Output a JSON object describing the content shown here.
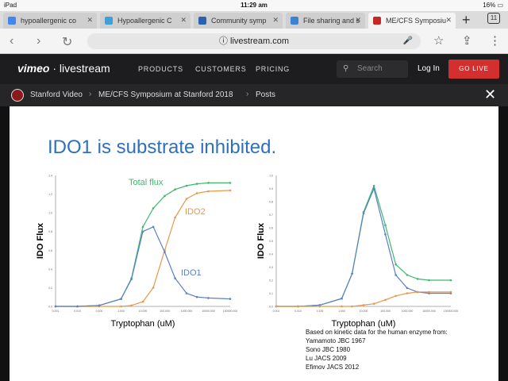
{
  "status": {
    "device": "iPad",
    "time": "11:29 am",
    "battery": "16%"
  },
  "tabs": [
    {
      "label": "hypoallergenic co",
      "icon_color": "#4285f4",
      "icon": "google-icon"
    },
    {
      "label": "Hypoallergenic C",
      "icon_color": "#3ea0d8",
      "icon": "site-icon"
    },
    {
      "label": "Community symp",
      "icon_color": "#2a62b0",
      "icon": "checkmark-icon"
    },
    {
      "label": "File sharing and s",
      "icon_color": "#3b82d6",
      "icon": "file-icon"
    },
    {
      "label": "ME/CFS Symposiu",
      "icon_color": "#c62828",
      "icon": "site-icon"
    }
  ],
  "tab_count": "11",
  "url": "livestream.com",
  "site": {
    "logo_vimeo": "vimeo",
    "logo_livestream": "· livestream",
    "nav": [
      "PRODUCTS",
      "CUSTOMERS",
      "PRICING"
    ],
    "search_placeholder": "Search",
    "login": "Log In",
    "golive": "GO LIVE"
  },
  "breadcrumb": [
    "Stanford Video",
    "ME/CFS Symposium at Stanford 2018",
    "Posts"
  ],
  "slide": {
    "title": "IDO1 is substrate inhibited.",
    "notes": [
      "Based on kinetic data for the human enzyme from:",
      "Yamamoto JBC 1967",
      "Sono JBC 1980",
      "Lu JACS 2009",
      "Efimov JACS 2012"
    ]
  },
  "colors": {
    "total": "#3fb86f",
    "ido1": "#5b7fc8",
    "ido2": "#e8974a"
  },
  "chart_data": [
    {
      "type": "line",
      "xlabel": "Tryptophan (uM)",
      "ylabel": "IDO Flux",
      "x_scale": "log",
      "x_ticks": [
        "0.001",
        "0.010",
        "0.100",
        "1.000",
        "10.000",
        "100.000",
        "1000.000",
        "10000.000",
        "100000.000"
      ],
      "y_ticks": [
        "0.0",
        "0.2",
        "0.4",
        "0.6",
        "0.8",
        "1.0",
        "1.2",
        "1.4"
      ],
      "ylim": [
        0,
        1.4
      ],
      "x": [
        0.001,
        0.01,
        0.1,
        1,
        3,
        10,
        30,
        100,
        300,
        1000,
        3000,
        10000,
        100000
      ],
      "series": [
        {
          "name": "Total flux",
          "color_key": "total",
          "values": [
            0.0,
            0.0,
            0.01,
            0.08,
            0.3,
            0.85,
            1.05,
            1.18,
            1.25,
            1.29,
            1.31,
            1.32,
            1.32
          ]
        },
        {
          "name": "IDO2",
          "color_key": "ido2",
          "values": [
            0.0,
            0.0,
            0.0,
            0.0,
            0.01,
            0.05,
            0.2,
            0.6,
            0.95,
            1.15,
            1.21,
            1.23,
            1.24
          ]
        },
        {
          "name": "IDO1",
          "color_key": "ido1",
          "values": [
            0.0,
            0.0,
            0.01,
            0.08,
            0.29,
            0.8,
            0.85,
            0.58,
            0.3,
            0.14,
            0.1,
            0.09,
            0.08
          ]
        }
      ]
    },
    {
      "type": "line",
      "xlabel": "Tryptophan (uM)",
      "ylabel": "IDO Flux",
      "x_scale": "log",
      "x_ticks": [
        "0.001",
        "0.010",
        "0.100",
        "1.000",
        "10.000",
        "100.000",
        "1000.000",
        "10000.000",
        "100000.000"
      ],
      "y_ticks": [
        "0.0",
        "0.1",
        "0.2",
        "0.3",
        "0.4",
        "0.5",
        "0.6",
        "0.7",
        "0.8",
        "0.9",
        "1.0"
      ],
      "ylim": [
        0,
        1.0
      ],
      "x": [
        0.001,
        0.01,
        0.1,
        1,
        3,
        10,
        30,
        100,
        300,
        1000,
        3000,
        10000,
        100000
      ],
      "series": [
        {
          "name": "Total flux",
          "color_key": "total",
          "values": [
            0.0,
            0.0,
            0.01,
            0.06,
            0.25,
            0.72,
            0.92,
            0.62,
            0.32,
            0.24,
            0.21,
            0.2,
            0.2
          ]
        },
        {
          "name": "IDO1",
          "color_key": "ido1",
          "values": [
            0.0,
            0.0,
            0.01,
            0.06,
            0.25,
            0.71,
            0.9,
            0.55,
            0.24,
            0.14,
            0.11,
            0.1,
            0.1
          ]
        },
        {
          "name": "IDO2",
          "color_key": "ido2",
          "values": [
            0.0,
            0.0,
            0.0,
            0.0,
            0.0,
            0.01,
            0.02,
            0.05,
            0.08,
            0.1,
            0.11,
            0.11,
            0.11
          ]
        }
      ]
    }
  ]
}
